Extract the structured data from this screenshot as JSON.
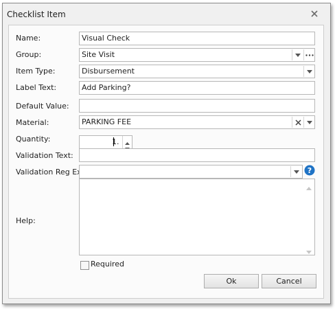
{
  "window": {
    "title": "Checklist Item"
  },
  "fields": {
    "name": {
      "label": "Name:",
      "value": "Visual Check"
    },
    "group": {
      "label": "Group:",
      "value": "Site Visit"
    },
    "item_type": {
      "label": "Item Type:",
      "value": "Disbursement"
    },
    "label_text": {
      "label": "Label Text:",
      "value": "Add Parking?"
    },
    "default_value": {
      "label": "Default Value:",
      "value": ""
    },
    "material": {
      "label": "Material:",
      "value": "PARKING FEE"
    },
    "quantity": {
      "label": "Quantity:",
      "value": "1."
    },
    "validation_text": {
      "label": "Validation Text:",
      "value": ""
    },
    "validation_regex": {
      "label": "Validation Reg Ex:",
      "value": ""
    },
    "help": {
      "label": "Help:",
      "value": ""
    }
  },
  "required": {
    "label": "Required",
    "checked": false
  },
  "buttons": {
    "ok": "Ok",
    "cancel": "Cancel"
  },
  "icons": {
    "close": "close-icon",
    "dropdown": "chevron-down-icon",
    "ellipsis": "ellipsis-icon",
    "clear": "clear-x-icon",
    "help": "question-icon",
    "spin_up": "spin-up-icon",
    "spin_down": "spin-down-icon"
  },
  "colors": {
    "help_icon": "#1f73c5",
    "border": "#b7b7b7",
    "panel": "#fbfbfb"
  }
}
